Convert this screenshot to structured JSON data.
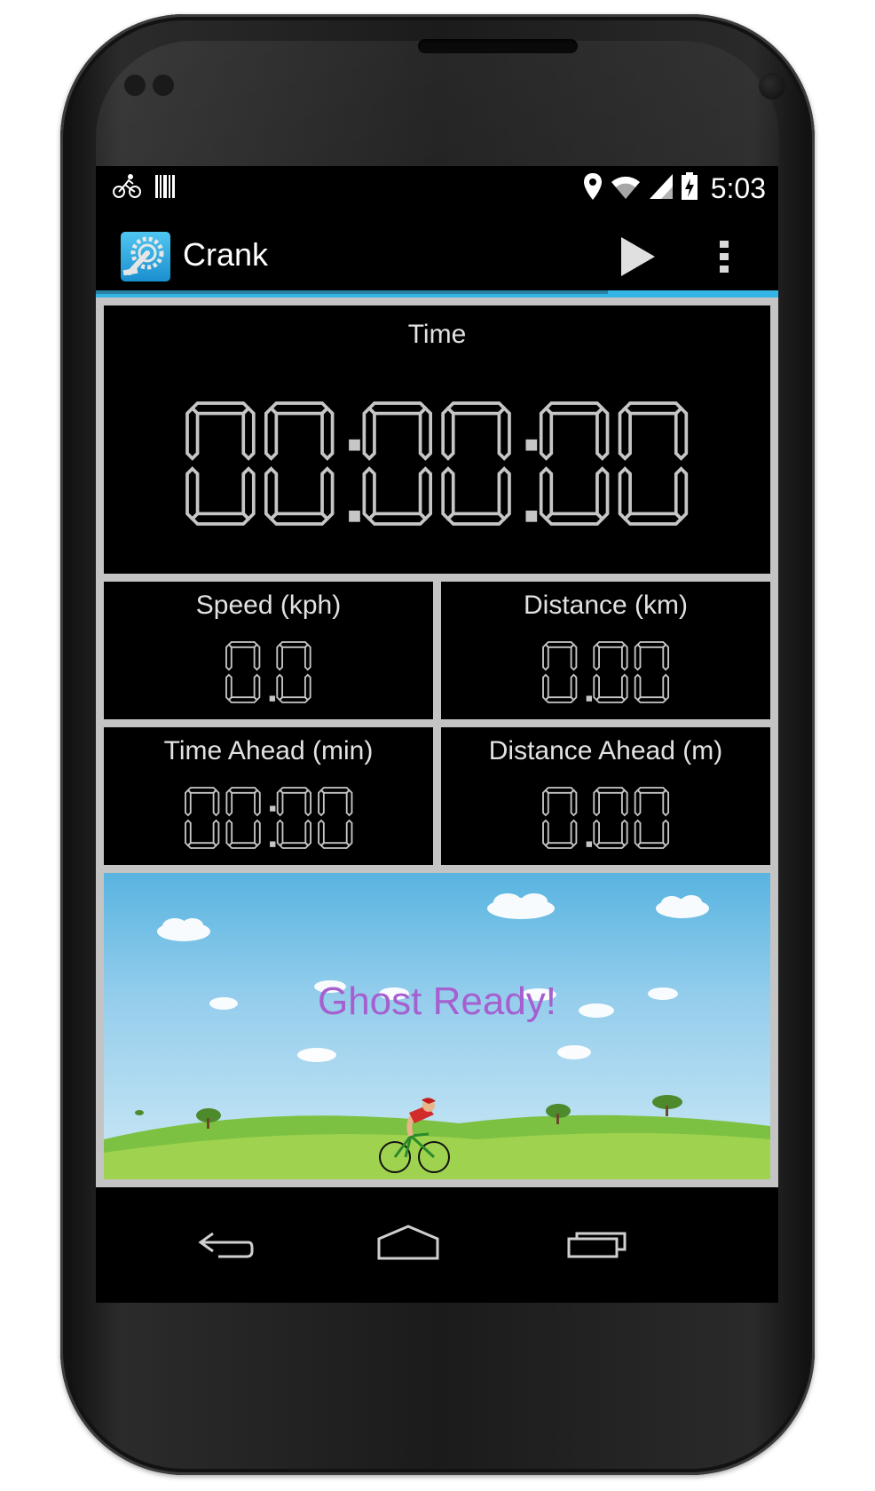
{
  "status_bar": {
    "time": "5:03",
    "left_icons": [
      "cyclist-icon",
      "barcode-icon"
    ],
    "right_icons": [
      "location-icon",
      "wifi-icon",
      "signal-icon",
      "battery-charging-icon"
    ]
  },
  "action_bar": {
    "title": "Crank",
    "actions": [
      "play-icon",
      "overflow-menu-icon"
    ],
    "progress_fraction": 0.75
  },
  "time_panel": {
    "label": "Time",
    "value": "00:00:00"
  },
  "stats": [
    {
      "label": "Speed  (kph)",
      "value": "0.0"
    },
    {
      "label": "Distance  (km)",
      "value": "0.00"
    },
    {
      "label": "Time Ahead  (min)",
      "value": "00:00"
    },
    {
      "label": "Distance Ahead  (m)",
      "value": "0.00"
    }
  ],
  "ghost": {
    "message": "Ghost Ready!"
  },
  "colors": {
    "accent": "#33b5e5",
    "panel_border": "#c4c4c4",
    "digit": "#c6c6c6",
    "ghost_text": "#a65fcf"
  },
  "nav_bar": [
    "back-icon",
    "home-icon",
    "recent-apps-icon"
  ]
}
